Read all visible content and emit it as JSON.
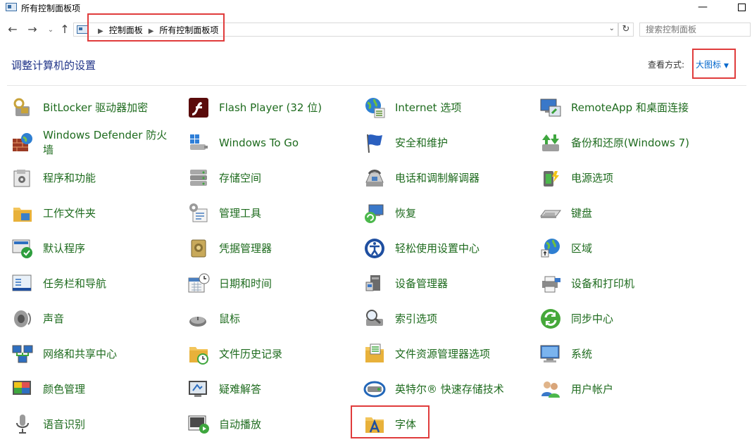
{
  "window": {
    "title": "所有控制面板项"
  },
  "titlebar": {
    "min_label": "—"
  },
  "nav": {
    "back": "←",
    "forward": "→",
    "recent": "⌄",
    "up": "↑",
    "breadcrumbs": [
      "控制面板",
      "所有控制面板项"
    ],
    "refresh": "↻",
    "dropdown": "⌄",
    "search_placeholder": "搜索控制面板"
  },
  "header": {
    "heading": "调整计算机的设置",
    "view_label": "查看方式:",
    "view_value": "大图标",
    "view_caret": "▼"
  },
  "colors": {
    "link_green": "#1e6b1e",
    "heading_blue": "#1e3287",
    "link_blue": "#0066cc",
    "highlight_red": "#e03c3c"
  },
  "items": [
    {
      "label": "BitLocker 驱动器加密",
      "icon": "bitlocker-icon"
    },
    {
      "label": "Flash Player (32 位)",
      "icon": "flash-player-icon"
    },
    {
      "label": "Internet 选项",
      "icon": "internet-options-icon"
    },
    {
      "label": "RemoteApp 和桌面连接",
      "icon": "remoteapp-icon"
    },
    {
      "label": "Windows Defender 防火墙",
      "icon": "firewall-icon"
    },
    {
      "label": "Windows To Go",
      "icon": "windows-to-go-icon"
    },
    {
      "label": "安全和维护",
      "icon": "security-flag-icon"
    },
    {
      "label": "备份和还原(Windows 7)",
      "icon": "backup-restore-icon"
    },
    {
      "label": "程序和功能",
      "icon": "programs-features-icon"
    },
    {
      "label": "存储空间",
      "icon": "storage-spaces-icon"
    },
    {
      "label": "电话和调制解调器",
      "icon": "phone-modem-icon"
    },
    {
      "label": "电源选项",
      "icon": "power-options-icon"
    },
    {
      "label": "工作文件夹",
      "icon": "work-folders-icon"
    },
    {
      "label": "管理工具",
      "icon": "admin-tools-icon"
    },
    {
      "label": "恢复",
      "icon": "recovery-icon"
    },
    {
      "label": "键盘",
      "icon": "keyboard-icon"
    },
    {
      "label": "默认程序",
      "icon": "default-programs-icon"
    },
    {
      "label": "凭据管理器",
      "icon": "credential-manager-icon"
    },
    {
      "label": "轻松使用设置中心",
      "icon": "ease-of-access-icon"
    },
    {
      "label": "区域",
      "icon": "region-icon"
    },
    {
      "label": "任务栏和导航",
      "icon": "taskbar-navigation-icon"
    },
    {
      "label": "日期和时间",
      "icon": "date-time-icon"
    },
    {
      "label": "设备管理器",
      "icon": "device-manager-icon"
    },
    {
      "label": "设备和打印机",
      "icon": "devices-printers-icon"
    },
    {
      "label": "声音",
      "icon": "sound-icon"
    },
    {
      "label": "鼠标",
      "icon": "mouse-icon"
    },
    {
      "label": "索引选项",
      "icon": "indexing-options-icon"
    },
    {
      "label": "同步中心",
      "icon": "sync-center-icon"
    },
    {
      "label": "网络和共享中心",
      "icon": "network-sharing-icon"
    },
    {
      "label": "文件历史记录",
      "icon": "file-history-icon"
    },
    {
      "label": "文件资源管理器选项",
      "icon": "explorer-options-icon"
    },
    {
      "label": "系统",
      "icon": "system-icon"
    },
    {
      "label": "颜色管理",
      "icon": "color-management-icon"
    },
    {
      "label": "疑难解答",
      "icon": "troubleshooting-icon"
    },
    {
      "label": "英特尔® 快速存储技术",
      "icon": "intel-rst-icon"
    },
    {
      "label": "用户帐户",
      "icon": "user-accounts-icon"
    },
    {
      "label": "语音识别",
      "icon": "speech-recognition-icon"
    },
    {
      "label": "自动播放",
      "icon": "autoplay-icon"
    },
    {
      "label": "字体",
      "icon": "fonts-icon"
    }
  ]
}
